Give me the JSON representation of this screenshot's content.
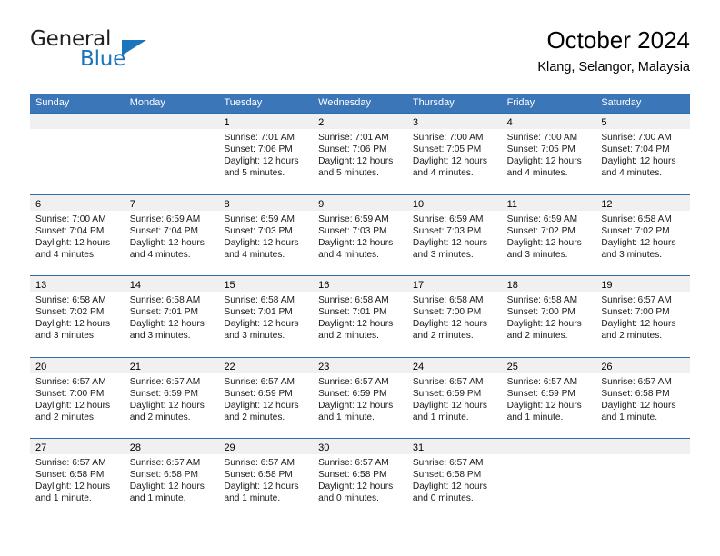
{
  "brand": {
    "name_part1": "General",
    "name_part2": "Blue",
    "triangle_color": "#1b75bc"
  },
  "header": {
    "title": "October 2024",
    "subtitle": "Klang, Selangor, Malaysia"
  },
  "theme": {
    "header_row_bg": "#3a76b8",
    "row_divider": "#2c6cb0",
    "daynum_band_bg": "#f0f0f0",
    "cell_bg": "#ffffff",
    "text": "#1a1a1a"
  },
  "weekday_headers": [
    "Sunday",
    "Monday",
    "Tuesday",
    "Wednesday",
    "Thursday",
    "Friday",
    "Saturday"
  ],
  "weeks": [
    [
      {
        "day": "",
        "lines": []
      },
      {
        "day": "",
        "lines": []
      },
      {
        "day": "1",
        "lines": [
          "Sunrise: 7:01 AM",
          "Sunset: 7:06 PM",
          "Daylight: 12 hours",
          "and 5 minutes."
        ]
      },
      {
        "day": "2",
        "lines": [
          "Sunrise: 7:01 AM",
          "Sunset: 7:06 PM",
          "Daylight: 12 hours",
          "and 5 minutes."
        ]
      },
      {
        "day": "3",
        "lines": [
          "Sunrise: 7:00 AM",
          "Sunset: 7:05 PM",
          "Daylight: 12 hours",
          "and 4 minutes."
        ]
      },
      {
        "day": "4",
        "lines": [
          "Sunrise: 7:00 AM",
          "Sunset: 7:05 PM",
          "Daylight: 12 hours",
          "and 4 minutes."
        ]
      },
      {
        "day": "5",
        "lines": [
          "Sunrise: 7:00 AM",
          "Sunset: 7:04 PM",
          "Daylight: 12 hours",
          "and 4 minutes."
        ]
      }
    ],
    [
      {
        "day": "6",
        "lines": [
          "Sunrise: 7:00 AM",
          "Sunset: 7:04 PM",
          "Daylight: 12 hours",
          "and 4 minutes."
        ]
      },
      {
        "day": "7",
        "lines": [
          "Sunrise: 6:59 AM",
          "Sunset: 7:04 PM",
          "Daylight: 12 hours",
          "and 4 minutes."
        ]
      },
      {
        "day": "8",
        "lines": [
          "Sunrise: 6:59 AM",
          "Sunset: 7:03 PM",
          "Daylight: 12 hours",
          "and 4 minutes."
        ]
      },
      {
        "day": "9",
        "lines": [
          "Sunrise: 6:59 AM",
          "Sunset: 7:03 PM",
          "Daylight: 12 hours",
          "and 4 minutes."
        ]
      },
      {
        "day": "10",
        "lines": [
          "Sunrise: 6:59 AM",
          "Sunset: 7:03 PM",
          "Daylight: 12 hours",
          "and 3 minutes."
        ]
      },
      {
        "day": "11",
        "lines": [
          "Sunrise: 6:59 AM",
          "Sunset: 7:02 PM",
          "Daylight: 12 hours",
          "and 3 minutes."
        ]
      },
      {
        "day": "12",
        "lines": [
          "Sunrise: 6:58 AM",
          "Sunset: 7:02 PM",
          "Daylight: 12 hours",
          "and 3 minutes."
        ]
      }
    ],
    [
      {
        "day": "13",
        "lines": [
          "Sunrise: 6:58 AM",
          "Sunset: 7:02 PM",
          "Daylight: 12 hours",
          "and 3 minutes."
        ]
      },
      {
        "day": "14",
        "lines": [
          "Sunrise: 6:58 AM",
          "Sunset: 7:01 PM",
          "Daylight: 12 hours",
          "and 3 minutes."
        ]
      },
      {
        "day": "15",
        "lines": [
          "Sunrise: 6:58 AM",
          "Sunset: 7:01 PM",
          "Daylight: 12 hours",
          "and 3 minutes."
        ]
      },
      {
        "day": "16",
        "lines": [
          "Sunrise: 6:58 AM",
          "Sunset: 7:01 PM",
          "Daylight: 12 hours",
          "and 2 minutes."
        ]
      },
      {
        "day": "17",
        "lines": [
          "Sunrise: 6:58 AM",
          "Sunset: 7:00 PM",
          "Daylight: 12 hours",
          "and 2 minutes."
        ]
      },
      {
        "day": "18",
        "lines": [
          "Sunrise: 6:58 AM",
          "Sunset: 7:00 PM",
          "Daylight: 12 hours",
          "and 2 minutes."
        ]
      },
      {
        "day": "19",
        "lines": [
          "Sunrise: 6:57 AM",
          "Sunset: 7:00 PM",
          "Daylight: 12 hours",
          "and 2 minutes."
        ]
      }
    ],
    [
      {
        "day": "20",
        "lines": [
          "Sunrise: 6:57 AM",
          "Sunset: 7:00 PM",
          "Daylight: 12 hours",
          "and 2 minutes."
        ]
      },
      {
        "day": "21",
        "lines": [
          "Sunrise: 6:57 AM",
          "Sunset: 6:59 PM",
          "Daylight: 12 hours",
          "and 2 minutes."
        ]
      },
      {
        "day": "22",
        "lines": [
          "Sunrise: 6:57 AM",
          "Sunset: 6:59 PM",
          "Daylight: 12 hours",
          "and 2 minutes."
        ]
      },
      {
        "day": "23",
        "lines": [
          "Sunrise: 6:57 AM",
          "Sunset: 6:59 PM",
          "Daylight: 12 hours",
          "and 1 minute."
        ]
      },
      {
        "day": "24",
        "lines": [
          "Sunrise: 6:57 AM",
          "Sunset: 6:59 PM",
          "Daylight: 12 hours",
          "and 1 minute."
        ]
      },
      {
        "day": "25",
        "lines": [
          "Sunrise: 6:57 AM",
          "Sunset: 6:59 PM",
          "Daylight: 12 hours",
          "and 1 minute."
        ]
      },
      {
        "day": "26",
        "lines": [
          "Sunrise: 6:57 AM",
          "Sunset: 6:58 PM",
          "Daylight: 12 hours",
          "and 1 minute."
        ]
      }
    ],
    [
      {
        "day": "27",
        "lines": [
          "Sunrise: 6:57 AM",
          "Sunset: 6:58 PM",
          "Daylight: 12 hours",
          "and 1 minute."
        ]
      },
      {
        "day": "28",
        "lines": [
          "Sunrise: 6:57 AM",
          "Sunset: 6:58 PM",
          "Daylight: 12 hours",
          "and 1 minute."
        ]
      },
      {
        "day": "29",
        "lines": [
          "Sunrise: 6:57 AM",
          "Sunset: 6:58 PM",
          "Daylight: 12 hours",
          "and 1 minute."
        ]
      },
      {
        "day": "30",
        "lines": [
          "Sunrise: 6:57 AM",
          "Sunset: 6:58 PM",
          "Daylight: 12 hours",
          "and 0 minutes."
        ]
      },
      {
        "day": "31",
        "lines": [
          "Sunrise: 6:57 AM",
          "Sunset: 6:58 PM",
          "Daylight: 12 hours",
          "and 0 minutes."
        ]
      },
      {
        "day": "",
        "lines": []
      },
      {
        "day": "",
        "lines": []
      }
    ]
  ]
}
